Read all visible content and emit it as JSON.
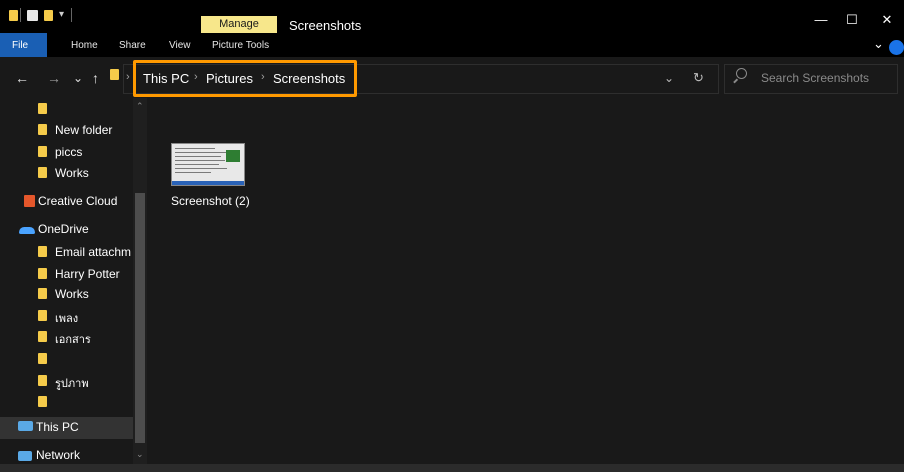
{
  "window": {
    "title": "Screenshots",
    "contextual_tab": "Manage",
    "contextual_group": "Picture Tools",
    "controls": {
      "minimize": "—",
      "maximize": "☐",
      "close": "✕"
    }
  },
  "ribbon": {
    "tabs": [
      "File",
      "Home",
      "Share",
      "View"
    ],
    "picture_tools_label": "Picture Tools",
    "expand": "⌄"
  },
  "nav": {
    "back": "←",
    "forward": "→",
    "recent": "⌄",
    "up": "↑",
    "breadcrumb": [
      "This PC",
      "Pictures",
      "Screenshots"
    ],
    "breadcrumb_sep": "›",
    "dropdown": "⌄",
    "refresh": "↻",
    "search_placeholder": "Search Screenshots"
  },
  "sidebar": {
    "items": [
      {
        "label": "",
        "icon": "folder-icon"
      },
      {
        "label": "New folder",
        "icon": "folder-icon"
      },
      {
        "label": "piccs",
        "icon": "folder-icon"
      },
      {
        "label": "Works",
        "icon": "folder-icon"
      },
      {
        "label": "Creative Cloud",
        "icon": "creative-cloud-icon"
      },
      {
        "label": "OneDrive",
        "icon": "onedrive-icon"
      },
      {
        "label": "Email attachm",
        "icon": "folder-icon"
      },
      {
        "label": "Harry Potter",
        "icon": "folder-icon"
      },
      {
        "label": "Works",
        "icon": "folder-icon"
      },
      {
        "label": "เพลง",
        "icon": "folder-icon"
      },
      {
        "label": "เอกสาร",
        "icon": "folder-icon"
      },
      {
        "label": "",
        "icon": "folder-icon"
      },
      {
        "label": "รูปภาพ",
        "icon": "folder-icon"
      },
      {
        "label": "",
        "icon": "folder-icon"
      },
      {
        "label": "This PC",
        "icon": "this-pc-icon"
      },
      {
        "label": "Network",
        "icon": "network-icon"
      }
    ]
  },
  "files": [
    {
      "name": "Screenshot (2)"
    }
  ],
  "colors": {
    "highlight": "#ff9900",
    "folder": "#f5cb4a",
    "file_tab": "#1a5fb4",
    "manage_tab": "#f7e78b"
  }
}
